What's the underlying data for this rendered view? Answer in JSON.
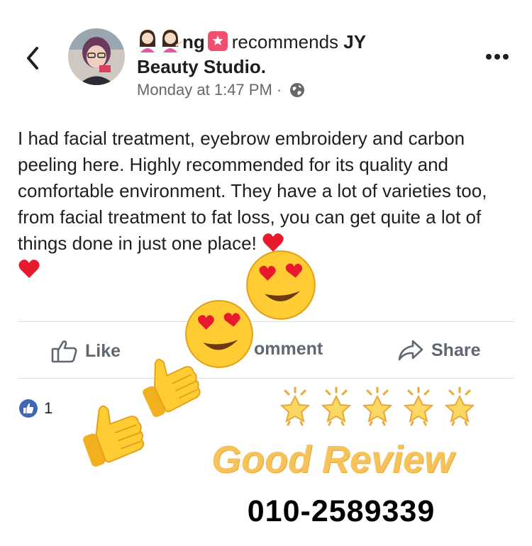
{
  "header": {
    "name_fragment": "ng",
    "recommends_text": "recommends",
    "page_name_part1": "JY",
    "page_name_part2": "Beauty Studio.",
    "timestamp": "Monday at 1:47 PM ·",
    "back_icon": "chevron-left-icon",
    "more_icon": "more-horizontal-icon",
    "privacy_icon": "globe-icon"
  },
  "post": {
    "text": "I had facial treatment, eyebrow embroidery and carbon peeling here. Highly recommended for its quality and comfortable environment. They have a lot of varieties too, from facial treatment to fat loss, you can get quite a lot of things done in just one place!"
  },
  "actions": {
    "like": "Like",
    "comment": "omment",
    "share": "Share"
  },
  "reactions": {
    "like_count": "1"
  },
  "overlay": {
    "review_label": "Good Review",
    "phone": "010-2589339",
    "rating_stars": 5,
    "accent_color": "#f6c35a",
    "fb_blue": "#4267b2"
  }
}
